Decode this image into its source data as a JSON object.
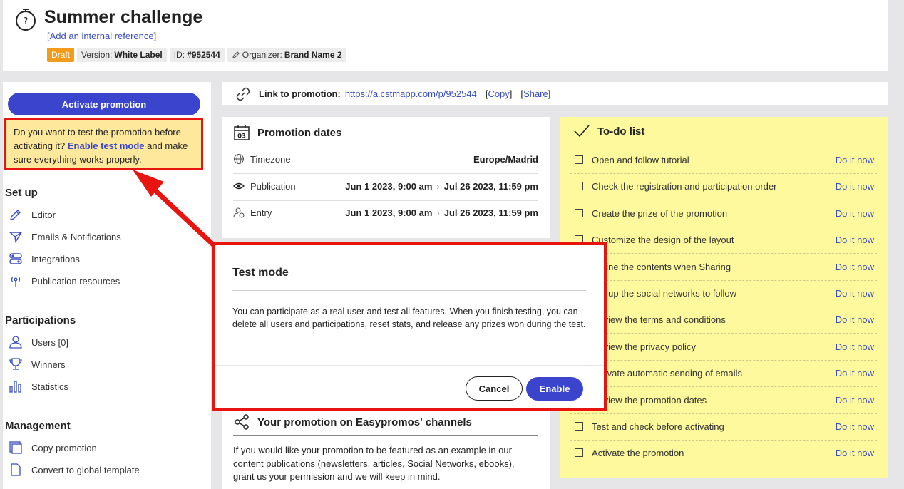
{
  "header": {
    "title": "Summer challenge",
    "internal_ref": "Add an internal reference",
    "badges": {
      "status": "Draft",
      "version_label": "Version:",
      "version_value": "White Label",
      "id_label": "ID:",
      "id_value": "#952544",
      "organizer_label": "Organizer:",
      "organizer_value": "Brand Name 2"
    }
  },
  "sidebar": {
    "activate_label": "Activate promotion",
    "test_note": {
      "before": "Do you want to test the promotion before activating it? ",
      "link": "Enable test mode",
      "after": " and make sure everything works properly."
    },
    "setup": {
      "title": "Set up",
      "items": [
        "Editor",
        "Emails & Notifications",
        "Integrations",
        "Publication resources"
      ]
    },
    "participations": {
      "title": "Participations",
      "items": [
        "Users [0]",
        "Winners",
        "Statistics"
      ]
    },
    "management": {
      "title": "Management",
      "items": [
        "Copy promotion",
        "Convert to global template"
      ]
    }
  },
  "linkbar": {
    "label": "Link to promotion:",
    "url": "https://a.cstmapp.com/p/952544",
    "copy": "Copy",
    "share": "Share"
  },
  "dates": {
    "title": "Promotion dates",
    "calendar_day": "03",
    "timezone_label": "Timezone",
    "timezone_value": "Europe/Madrid",
    "publication_label": "Publication",
    "publication_start": "Jun 1 2023, 9:00 am",
    "publication_end": "Jul 26 2023, 11:59 pm",
    "entry_label": "Entry",
    "entry_start": "Jun 1 2023, 9:00 am",
    "entry_end": "Jul 26 2023, 11:59 pm"
  },
  "todo": {
    "title": "To-do list",
    "action": "Do it now",
    "items": [
      "Open and follow tutorial",
      "Check the registration and participation order",
      "Create the prize of the promotion",
      "Customize the design of the layout",
      "Define the contents when Sharing",
      "Set up the social networks to follow",
      "Review the terms and conditions",
      "Review the privacy policy",
      "Activate automatic sending of emails",
      "Review the promotion dates",
      "Test and check before activating",
      "Activate the promotion"
    ]
  },
  "channels": {
    "title": "Your promotion on Easypromos' channels",
    "text": "If you would like your promotion to be featured as an example in our content publications (newsletters, articles, Social Networks, ebooks), grant us your permission and we will keep in mind."
  },
  "modal": {
    "title": "Test mode",
    "text": "You can participate as a real user and test all features. When you finish testing, you can delete all users and participations, reset stats, and release any prizes won during the test.",
    "cancel": "Cancel",
    "enable": "Enable"
  },
  "colors": {
    "accent": "#3a44cc",
    "highlight": "#e8140f",
    "todo_bg": "#fdf99c",
    "note_bg": "#fde89b",
    "draft": "#f39c1a"
  }
}
